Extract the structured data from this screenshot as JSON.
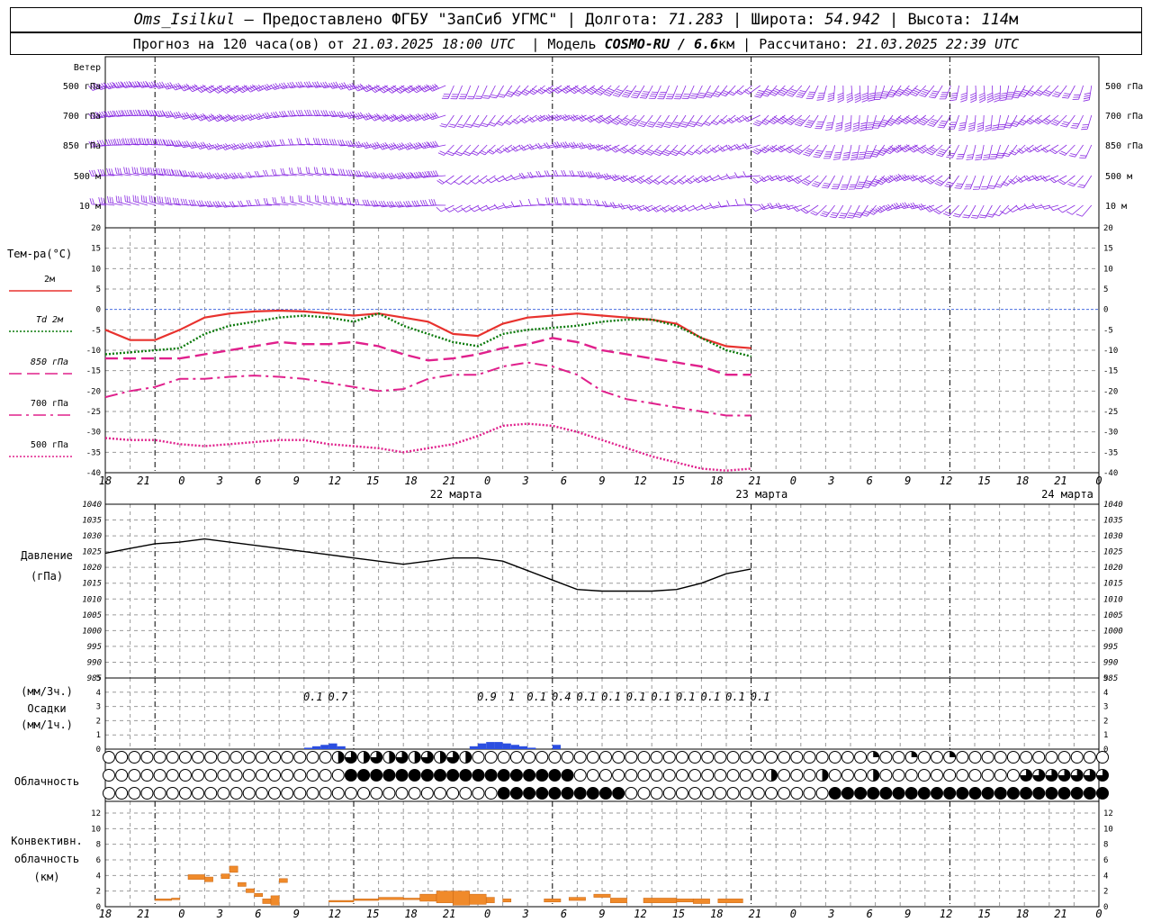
{
  "header": {
    "station": "Oms_Isilkul",
    "provided_by": "– Предоставлено ФГБУ \"ЗапСиб УГМС\"",
    "lon_label": "Долгота:",
    "lon": "71.283",
    "lat_label": "Широта:",
    "lat": "54.942",
    "alt_label": "Высота:",
    "alt": "114",
    "alt_unit": "м",
    "forecast_prefix": "Прогноз на 120 часа(ов) от",
    "forecast_start": "21.03.2025 18:00 UTC",
    "model_label": "Модель",
    "model_name": "COSMO-RU / 6.6",
    "model_unit": "км",
    "calc_label": "Рассчитано:",
    "calc_time": "21.03.2025 22:39 UTC"
  },
  "time_axis": {
    "hour_labels": [
      "18",
      "21",
      "0",
      "3",
      "6",
      "9",
      "12",
      "15",
      "18",
      "21",
      "0",
      "3",
      "6",
      "9",
      "12",
      "15",
      "18",
      "21",
      "0",
      "3",
      "6",
      "9",
      "12",
      "15",
      "18",
      "21",
      "0"
    ],
    "day_labels": [
      "22 марта",
      "23 марта",
      "24 марта"
    ]
  },
  "wind": {
    "title": "Ветер",
    "levels": [
      "500 гПа",
      "700 гПа",
      "850 гПа",
      "500 м",
      "10 м"
    ],
    "color": "#8a2be2"
  },
  "temperature": {
    "title": "Тем-ра(°C)",
    "legend": [
      {
        "label": "2м",
        "color": "#e8322e",
        "style": "solid"
      },
      {
        "label": "Td 2м",
        "color": "#0b7a0b",
        "style": "dotted"
      },
      {
        "label": "850 гПа",
        "color": "#e0208c",
        "style": "dashed"
      },
      {
        "label": "700 гПа",
        "color": "#e0208c",
        "style": "dashdot"
      },
      {
        "label": "500 гПа",
        "color": "#e0208c",
        "style": "dotted"
      }
    ],
    "ticks": [
      "20",
      "15",
      "10",
      "5",
      "0",
      "-5",
      "-10",
      "-15",
      "-20",
      "-25",
      "-30",
      "-35",
      "-40"
    ]
  },
  "pressure": {
    "title": "Давление",
    "unit": "(гПа)",
    "ticks": [
      "1040",
      "1035",
      "1030",
      "1025",
      "1020",
      "1015",
      "1010",
      "1005",
      "1000",
      "995",
      "990",
      "985"
    ]
  },
  "precip": {
    "unit3": "(мм/3ч.)",
    "title": "Осадки",
    "unit1": "(мм/1ч.)",
    "ticks": [
      "5",
      "4",
      "3",
      "2",
      "1",
      "0"
    ],
    "amount_labels": [
      {
        "h": 24,
        "text": "0.1"
      },
      {
        "h": 27,
        "text": "0.7"
      },
      {
        "h": 45,
        "text": "0.9"
      },
      {
        "h": 48,
        "text": "1"
      },
      {
        "h": 51,
        "text": "0.1"
      },
      {
        "h": 54,
        "text": "0.4"
      },
      {
        "h": 57,
        "text": "0.1"
      },
      {
        "h": 60,
        "text": "0.1"
      },
      {
        "h": 63,
        "text": "0.1"
      },
      {
        "h": 66,
        "text": "0.1"
      },
      {
        "h": 69,
        "text": "0.1"
      },
      {
        "h": 72,
        "text": "0.1"
      },
      {
        "h": 75,
        "text": "0.1"
      },
      {
        "h": 78,
        "text": "0.1"
      }
    ]
  },
  "cloud": {
    "title": "Облачность"
  },
  "convective": {
    "title1": "Конвективн.",
    "title2": "облачность",
    "unit": "(км)",
    "ticks": [
      "12",
      "10",
      "8",
      "6",
      "4",
      "2",
      "0"
    ]
  },
  "chart_data": [
    {
      "type": "line",
      "title": "Тем-ра(°C)",
      "x_unit": "hours from 21.03.2025 18:00 UTC",
      "ylim": [
        -40,
        20
      ],
      "series": [
        {
          "name": "2м",
          "x": [
            0,
            3,
            6,
            9,
            12,
            15,
            18,
            21,
            24,
            27,
            30,
            33,
            36,
            39,
            42,
            45,
            48,
            51,
            54,
            57,
            60,
            63,
            66,
            69,
            72,
            75,
            78
          ],
          "values": [
            -5,
            -7.5,
            -7.5,
            -5,
            -2,
            -1,
            -0.5,
            -0.3,
            -0.5,
            -1,
            -1.5,
            -1,
            -2,
            -3,
            -6,
            -6.5,
            -3.5,
            -2,
            -1.5,
            -1,
            -1.5,
            -2,
            -2.5,
            -3.5,
            -7,
            -9,
            -9.5
          ]
        },
        {
          "name": "Td 2м",
          "x": [
            0,
            3,
            6,
            9,
            12,
            15,
            18,
            21,
            24,
            27,
            30,
            33,
            36,
            39,
            42,
            45,
            48,
            51,
            54,
            57,
            60,
            63,
            66,
            69,
            72,
            75,
            78
          ],
          "values": [
            -11,
            -10.5,
            -10,
            -9.5,
            -6,
            -4,
            -3,
            -2,
            -1.5,
            -2,
            -3,
            -1,
            -4,
            -6,
            -8,
            -9,
            -6,
            -5,
            -4.5,
            -4,
            -3,
            -2.5,
            -2.5,
            -4,
            -7,
            -10,
            -11.5
          ]
        },
        {
          "name": "850 гПа",
          "x": [
            0,
            3,
            6,
            9,
            12,
            15,
            18,
            21,
            24,
            27,
            30,
            33,
            36,
            39,
            42,
            45,
            48,
            51,
            54,
            57,
            60,
            63,
            66,
            69,
            72,
            75,
            78
          ],
          "values": [
            -12,
            -12,
            -12,
            -12,
            -11,
            -10,
            -9,
            -8,
            -8.5,
            -8.5,
            -8,
            -9,
            -11,
            -12.5,
            -12,
            -11,
            -9.5,
            -8.5,
            -7,
            -8,
            -10,
            -11,
            -12,
            -13,
            -14,
            -16,
            -16
          ]
        },
        {
          "name": "700 гПа",
          "x": [
            0,
            3,
            6,
            9,
            12,
            15,
            18,
            21,
            24,
            27,
            30,
            33,
            36,
            39,
            42,
            45,
            48,
            51,
            54,
            57,
            60,
            63,
            66,
            69,
            72,
            75,
            78
          ],
          "values": [
            -21.5,
            -20,
            -19,
            -17,
            -17,
            -16.5,
            -16.2,
            -16.5,
            -17,
            -18,
            -19,
            -20,
            -19.5,
            -17,
            -16,
            -16,
            -14,
            -13,
            -14,
            -16,
            -20,
            -22,
            -23,
            -24,
            -25,
            -26,
            -26
          ]
        },
        {
          "name": "500 гПа",
          "x": [
            0,
            3,
            6,
            9,
            12,
            15,
            18,
            21,
            24,
            27,
            30,
            33,
            36,
            39,
            42,
            45,
            48,
            51,
            54,
            57,
            60,
            63,
            66,
            69,
            72,
            75,
            78
          ],
          "values": [
            -31.5,
            -32,
            -32,
            -33,
            -33.5,
            -33,
            -32.5,
            -32,
            -32,
            -33,
            -33.5,
            -34,
            -35,
            -34,
            -33,
            -31,
            -28.5,
            -28,
            -28.5,
            -30,
            -32,
            -34,
            -36,
            -37.5,
            -39,
            -39.5,
            -39
          ]
        }
      ]
    },
    {
      "type": "line",
      "title": "Давление",
      "x_unit": "hours from 21.03.2025 18:00 UTC",
      "ylim": [
        985,
        1040
      ],
      "series": [
        {
          "name": "Давление",
          "x": [
            0,
            3,
            6,
            9,
            12,
            15,
            18,
            21,
            24,
            27,
            30,
            33,
            36,
            39,
            42,
            45,
            48,
            51,
            54,
            57,
            60,
            63,
            66,
            69,
            72,
            75,
            78
          ],
          "values": [
            1024.5,
            1026,
            1027.5,
            1028,
            1029,
            1028,
            1027,
            1026,
            1025,
            1024,
            1023,
            1022,
            1021,
            1022,
            1023,
            1023,
            1022,
            1019,
            1016,
            1013,
            1012.5,
            1012.5,
            1012.5,
            1013,
            1015,
            1018,
            1019.5
          ]
        }
      ]
    },
    {
      "type": "bar",
      "title": "Осадки",
      "x_unit": "hours from 21.03.2025 18:00 UTC",
      "ylim": [
        0,
        5
      ],
      "x": [
        24,
        25,
        26,
        27,
        28,
        44,
        45,
        46,
        47,
        48,
        49,
        50,
        51,
        54
      ],
      "values": [
        0.1,
        0.2,
        0.3,
        0.4,
        0.2,
        0.2,
        0.4,
        0.5,
        0.5,
        0.4,
        0.3,
        0.2,
        0.1,
        0.3
      ]
    },
    {
      "type": "bar",
      "title": "Конвективн. облачность",
      "x_unit": "hours from 21.03.2025 18:00 UTC",
      "ylim": [
        0,
        13
      ],
      "segments": [
        {
          "x0": 6,
          "x1": 8,
          "bottom": 0.8,
          "top": 1.0
        },
        {
          "x0": 8,
          "x1": 9,
          "bottom": 0.9,
          "top": 1.1
        },
        {
          "x0": 10,
          "x1": 12,
          "bottom": 3.5,
          "top": 4.1
        },
        {
          "x0": 12,
          "x1": 13,
          "bottom": 3.2,
          "top": 3.8
        },
        {
          "x0": 14,
          "x1": 15,
          "bottom": 3.6,
          "top": 4.2
        },
        {
          "x0": 15,
          "x1": 16,
          "bottom": 4.4,
          "top": 5.2
        },
        {
          "x0": 16,
          "x1": 17,
          "bottom": 2.6,
          "top": 3.1
        },
        {
          "x0": 17,
          "x1": 18,
          "bottom": 1.8,
          "top": 2.3
        },
        {
          "x0": 18,
          "x1": 19,
          "bottom": 1.3,
          "top": 1.7
        },
        {
          "x0": 19,
          "x1": 20,
          "bottom": 0.4,
          "top": 1.0
        },
        {
          "x0": 20,
          "x1": 21,
          "bottom": 0.2,
          "top": 1.4
        },
        {
          "x0": 21,
          "x1": 22,
          "bottom": 3.1,
          "top": 3.6
        },
        {
          "x0": 27,
          "x1": 30,
          "bottom": 0.6,
          "top": 0.8
        },
        {
          "x0": 30,
          "x1": 33,
          "bottom": 0.8,
          "top": 1.0
        },
        {
          "x0": 33,
          "x1": 36,
          "bottom": 0.9,
          "top": 1.2
        },
        {
          "x0": 36,
          "x1": 38,
          "bottom": 0.9,
          "top": 1.1
        },
        {
          "x0": 38,
          "x1": 40,
          "bottom": 0.7,
          "top": 1.6
        },
        {
          "x0": 40,
          "x1": 42,
          "bottom": 0.5,
          "top": 2.0
        },
        {
          "x0": 42,
          "x1": 44,
          "bottom": 0.2,
          "top": 2.0
        },
        {
          "x0": 44,
          "x1": 46,
          "bottom": 0.3,
          "top": 1.6
        },
        {
          "x0": 46,
          "x1": 47,
          "bottom": 0.5,
          "top": 1.2
        },
        {
          "x0": 48,
          "x1": 49,
          "bottom": 0.6,
          "top": 1.0
        },
        {
          "x0": 53,
          "x1": 55,
          "bottom": 0.6,
          "top": 1.0
        },
        {
          "x0": 56,
          "x1": 58,
          "bottom": 0.8,
          "top": 1.2
        },
        {
          "x0": 59,
          "x1": 61,
          "bottom": 1.2,
          "top": 1.6
        },
        {
          "x0": 61,
          "x1": 63,
          "bottom": 0.5,
          "top": 1.1
        },
        {
          "x0": 65,
          "x1": 69,
          "bottom": 0.5,
          "top": 1.1
        },
        {
          "x0": 69,
          "x1": 71,
          "bottom": 0.6,
          "top": 1.0
        },
        {
          "x0": 71,
          "x1": 73,
          "bottom": 0.4,
          "top": 1.0
        },
        {
          "x0": 74,
          "x1": 77,
          "bottom": 0.5,
          "top": 1.0
        }
      ]
    }
  ]
}
